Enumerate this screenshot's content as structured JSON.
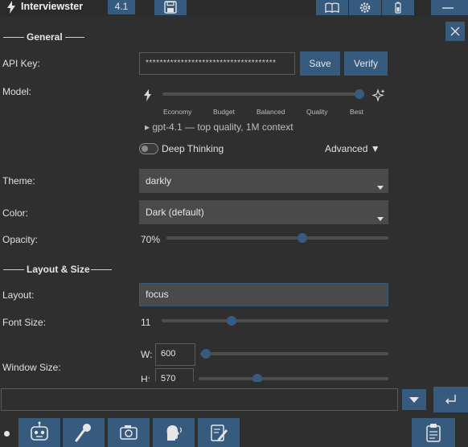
{
  "titlebar": {
    "app_name": "Interviewster",
    "model_badge": "4.1"
  },
  "colors": {
    "accent": "#375a7f",
    "background": "#2f2f2f",
    "surface": "#4a4a4a"
  },
  "general": {
    "heading": "General",
    "api_key_label": "API Key:",
    "api_key_value": "*************************************",
    "save_label": "Save",
    "verify_label": "Verify",
    "model_label": "Model:",
    "model_stops": [
      "Economy",
      "Budget",
      "Balanced",
      "Quality",
      "Best"
    ],
    "model_level": "Best",
    "model_summary": "▸ gpt-4.1 — top quality, 1M context",
    "deep_thinking_label": "Deep Thinking",
    "deep_thinking_on": false,
    "advanced_label": "Advanced ▼",
    "theme_label": "Theme:",
    "theme_value": "darkly",
    "color_label": "Color:",
    "color_value": "Dark (default)",
    "opacity_label": "Opacity:",
    "opacity_value": "70%",
    "opacity_level": 0.6
  },
  "layout_size": {
    "heading": "Layout & Size",
    "layout_label": "Layout:",
    "layout_value": "focus",
    "font_size_label": "Font Size:",
    "font_size_value": "11",
    "font_size_level": 0.3,
    "window_size_label": "Window Size:",
    "width_label": "W:",
    "width_value": "600",
    "width_level": 0.03,
    "height_label": "H:",
    "height_value": "570",
    "height_level": 0.3
  },
  "bottom": {
    "input_value": "",
    "enter_icon": "enter-icon",
    "toolbar_icons": [
      "robot-icon",
      "microphone-icon",
      "camera-icon",
      "speaking-head-icon",
      "edit-icon",
      "clipboard-icon"
    ]
  }
}
